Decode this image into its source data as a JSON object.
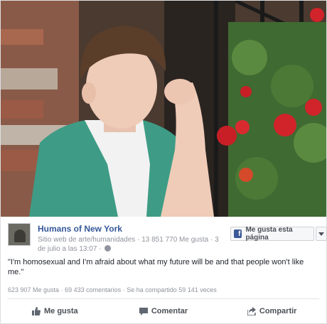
{
  "post": {
    "page_name": "Humans of New York",
    "category": "Sitio web de arte/humanidades",
    "separator_1": "·",
    "likes_count": "13 851 770 Me gusta",
    "separator_2": "·",
    "date": "3 de julio a las 13:07",
    "separator_3": "·",
    "privacy_icon": "globe-icon",
    "like_page_label": "Me gusta esta página",
    "quote": "\"I'm homosexual and I'm afraid about what my future will be and that people won't like me.\"",
    "stats": {
      "likes": "623 907 Me gusta",
      "dot_1": "·",
      "comments": "69 433 comentarios",
      "dot_2": "·",
      "shares": "Se ha compartido 59 141 veces"
    },
    "actions": {
      "like": "Me gusta",
      "comment": "Comentar",
      "share": "Compartir"
    }
  },
  "colors": {
    "page_name": "#365899",
    "meta_text": "#90949c",
    "facebook_blue": "#3b5998",
    "action_text": "#4b4f56"
  }
}
